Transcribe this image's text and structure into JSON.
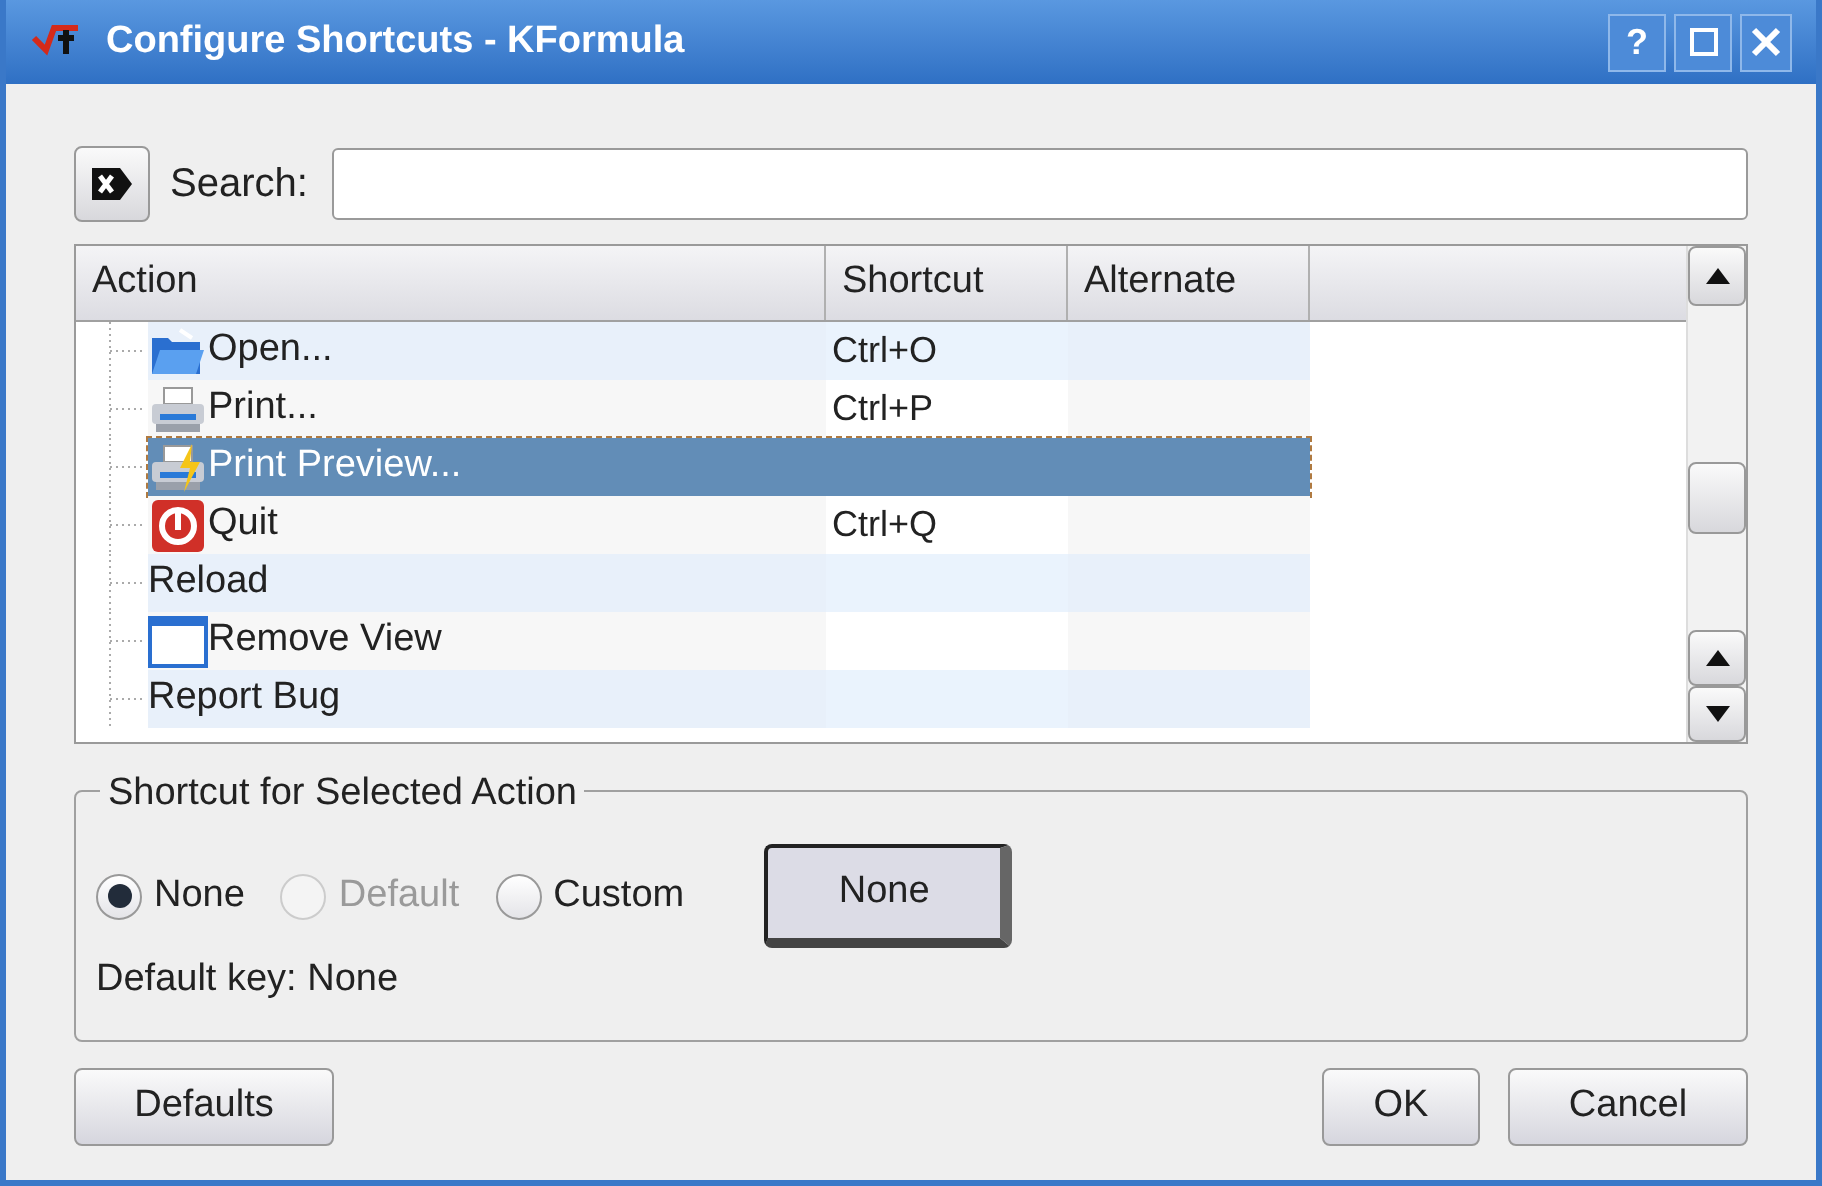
{
  "window": {
    "title": "Configure Shortcuts - KFormula",
    "buttons": [
      "?"
    ]
  },
  "search": {
    "label": "Search:"
  },
  "table": {
    "columns": [
      "Action",
      "Shortcut",
      "Alternate"
    ],
    "rows": [
      {
        "action": "Open...",
        "kind": "folder",
        "shortcut": "Ctrl+O",
        "selected": false
      },
      {
        "action": "Print...",
        "kind": "printer",
        "shortcut": "Ctrl+P",
        "selected": false
      },
      {
        "action": "Print Preview...",
        "kind": "preview",
        "selected": true
      },
      {
        "action": "Quit",
        "kind": "quit",
        "shortcut": "Ctrl+Q",
        "selected": false
      },
      {
        "action": "Reload",
        "kind": "plain",
        "selected": false
      },
      {
        "action": "Remove View",
        "kind": "window",
        "selected": false
      },
      {
        "action": "Report Bug",
        "kind": "plain",
        "selected": false
      }
    ]
  },
  "shortcut_group": {
    "title": "Shortcut for Selected Action",
    "options": [
      {
        "label": "None",
        "selected": true,
        "disabled": false
      },
      {
        "label": "Default",
        "selected": false,
        "disabled": true
      },
      {
        "label": "Custom",
        "selected": false,
        "disabled": false
      }
    ],
    "key_button": "None",
    "default_key": "Default key: None"
  },
  "buttons": {
    "defaults": "Defaults",
    "ok": "OK",
    "cancel": "Cancel"
  }
}
